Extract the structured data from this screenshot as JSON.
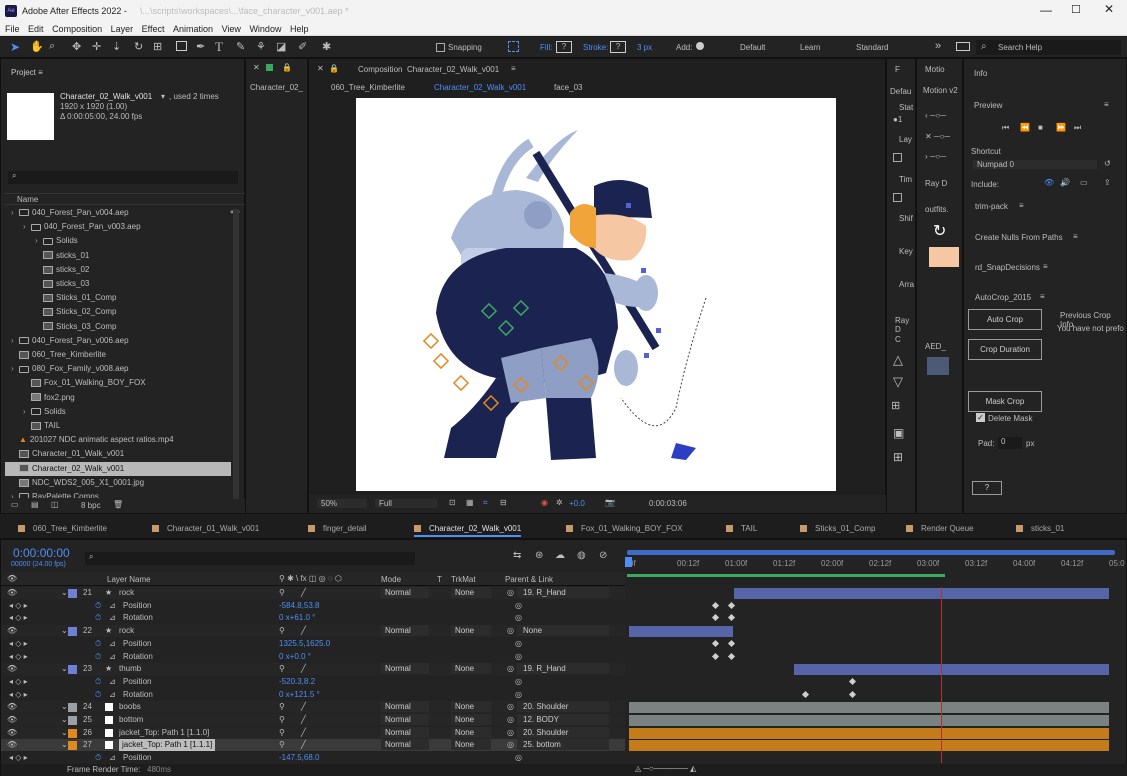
{
  "app": {
    "title": "Adobe After Effects 2022 - ",
    "title_path": "\\...\\scripts\\workspaces\\...\\face_character_v001.aep *",
    "menus": [
      "File",
      "Edit",
      "Composition",
      "Layer",
      "Effect",
      "Animation",
      "View",
      "Window",
      "Help"
    ]
  },
  "toolbar": {
    "snapping": "Snapping",
    "fill": "Fill:",
    "stroke": "Stroke:",
    "stroke_px": "3 px",
    "add": "Add:",
    "workspaces": [
      "Default",
      "Learn",
      "Standard"
    ],
    "search": "Search Help"
  },
  "project": {
    "tab": "Project",
    "item_name": "Character_02_Walk_v001",
    "used": ", used 2 times",
    "dims": "1920 x 1920 (1.00)",
    "duration": "Δ 0:00:05:00, 24.00 fps",
    "col_name": "Name",
    "items": [
      {
        "label": "040_Forest_Pan_v004.aep",
        "kind": "folder",
        "indent": 0
      },
      {
        "label": "040_Forest_Pan_v003.aep",
        "kind": "folder",
        "indent": 1
      },
      {
        "label": "Solids",
        "kind": "folder",
        "indent": 2
      },
      {
        "label": "sticks_01",
        "kind": "comp",
        "indent": 2
      },
      {
        "label": "sticks_02",
        "kind": "comp",
        "indent": 2
      },
      {
        "label": "sticks_03",
        "kind": "comp",
        "indent": 2
      },
      {
        "label": "Sticks_01_Comp",
        "kind": "comp",
        "indent": 2
      },
      {
        "label": "Sticks_02_Comp",
        "kind": "comp",
        "indent": 2
      },
      {
        "label": "Sticks_03_Comp",
        "kind": "comp",
        "indent": 2
      },
      {
        "label": "040_Forest_Pan_v006.aep",
        "kind": "folder",
        "indent": 0
      },
      {
        "label": "060_Tree_Kimberlite",
        "kind": "comp",
        "indent": 0
      },
      {
        "label": "080_Fox_Family_v008.aep",
        "kind": "folder",
        "indent": 0
      },
      {
        "label": "Fox_01_Walking_BOY_FOX",
        "kind": "comp",
        "indent": 1
      },
      {
        "label": "fox2.png",
        "kind": "file",
        "indent": 1
      },
      {
        "label": "Solids",
        "kind": "folder",
        "indent": 1
      },
      {
        "label": "TAIL",
        "kind": "comp",
        "indent": 1
      },
      {
        "label": "201027 NDC animatic aspect ratios.mp4",
        "kind": "media",
        "indent": 0
      },
      {
        "label": "Character_01_Walk_v001",
        "kind": "comp",
        "indent": 0
      },
      {
        "label": "Character_02_Walk_v001",
        "kind": "comp",
        "indent": 0,
        "selected": true
      },
      {
        "label": "NDC_WDS2_005_X1_0001.jpg",
        "kind": "file",
        "indent": 0
      },
      {
        "label": "RayPalette Comps",
        "kind": "folder",
        "indent": 0
      }
    ],
    "bpc": "8 bpc"
  },
  "flow": {
    "tab": "Character_02_"
  },
  "composition": {
    "tab_prefix": "Composition",
    "tab_name": "Character_02_Walk_v001",
    "crumbs": [
      "060_Tree_Kimberlite",
      "Character_02_Walk_v001",
      "face_03"
    ],
    "zoom": "50%",
    "quality": "Full",
    "exposure": "+0.0",
    "timecode": "0:00:03:06"
  },
  "side": {
    "f_tab": "F",
    "motion_tab": "Motio",
    "default": "Defau",
    "motion_v2": "Motion v2",
    "stat": "Stat",
    "lay": "Lay",
    "tim": "Tim",
    "ray_d": "Ray D",
    "shif": "Shif",
    "key": "Key",
    "arra": "Arra",
    "outfits": "outfits.",
    "ray_d2": "Ray D",
    "c": "C",
    "aed": "AED_"
  },
  "info": {
    "tab": "Info",
    "preview_tab": "Preview",
    "shortcut": "Shortcut",
    "shortcut_val": "Numpad 0",
    "include": "Include:",
    "trim": "trim-pack",
    "nulls": "Create Nulls From Paths",
    "snap": "rd_SnapDecisions",
    "autocrop": "AutoCrop_2015",
    "auto_crop": "Auto Crop",
    "crop_duration": "Crop Duration",
    "mask_crop": "Mask Crop",
    "delete_mask": "Delete Mask",
    "pad": "Pad:",
    "pad_val": "0",
    "px": "px",
    "help": "?",
    "prev_info": "Previous Crop Info",
    "no_prev": "You have not prefo"
  },
  "timeline": {
    "tabs": [
      "060_Tree_Kimberlite",
      "Character_01_Walk_v001",
      "finger_detail",
      "Character_02_Walk_v001",
      "Fox_01_Walking_BOY_FOX",
      "TAIL",
      "Sticks_01_Comp",
      "Render Queue",
      "sticks_01"
    ],
    "timecode": "0:00:00:00",
    "fps": "00000 (24.00 fps)",
    "col_layer": "Layer Name",
    "col_mode": "Mode",
    "col_t": "T",
    "col_trkmat": "TrkMat",
    "col_parent": "Parent & Link",
    "ruler": [
      "0f",
      "00:12f",
      "01:00f",
      "01:12f",
      "02:00f",
      "02:12f",
      "03:00f",
      "03:12f",
      "04:00f",
      "04:12f",
      "05:0"
    ],
    "rows": [
      {
        "type": "layer",
        "num": "21",
        "name": "rock",
        "color": "#6f7fd6",
        "mode": "Normal",
        "trk": "None",
        "parent": "19. R_Hand",
        "star": true
      },
      {
        "type": "prop",
        "name": "Position",
        "value": "-584.8,53.8"
      },
      {
        "type": "prop",
        "name": "Rotation",
        "value": "0 x+61.0 °"
      },
      {
        "type": "layer",
        "num": "22",
        "name": "rock",
        "color": "#6f7fd6",
        "mode": "Normal",
        "trk": "None",
        "parent": "None",
        "star": true
      },
      {
        "type": "prop",
        "name": "Position",
        "value": "1325.5,1625.0"
      },
      {
        "type": "prop",
        "name": "Rotation",
        "value": "0 x+0.0 °"
      },
      {
        "type": "layer",
        "num": "23",
        "name": "thumb",
        "color": "#6f7fd6",
        "mode": "Normal",
        "trk": "None",
        "parent": "19. R_Hand",
        "star": true
      },
      {
        "type": "prop",
        "name": "Position",
        "value": "-520.3,8.2"
      },
      {
        "type": "prop",
        "name": "Rotation",
        "value": "0 x+121.5 °"
      },
      {
        "type": "layer",
        "num": "24",
        "name": "boobs",
        "color": "#9aa0a6",
        "mode": "Normal",
        "trk": "None",
        "parent": "20. Shoulder"
      },
      {
        "type": "layer",
        "num": "25",
        "name": "bottom",
        "color": "#9aa0a6",
        "mode": "Normal",
        "trk": "None",
        "parent": "12. BODY"
      },
      {
        "type": "layer",
        "num": "26",
        "name": "jacket_Top: Path 1 [1.1.0]",
        "color": "#e08a1e",
        "mode": "Normal",
        "trk": "None",
        "parent": "20. Shoulder"
      },
      {
        "type": "layer",
        "num": "27",
        "name": "jacket_Top: Path 1 [1.1.1]",
        "color": "#e08a1e",
        "mode": "Normal",
        "trk": "None",
        "parent": "25. bottom",
        "selected": true
      },
      {
        "type": "prop",
        "name": "Position",
        "value": "-147.5,68.0"
      }
    ],
    "render_time": "Frame Render Time:",
    "render_val": "480ms"
  }
}
